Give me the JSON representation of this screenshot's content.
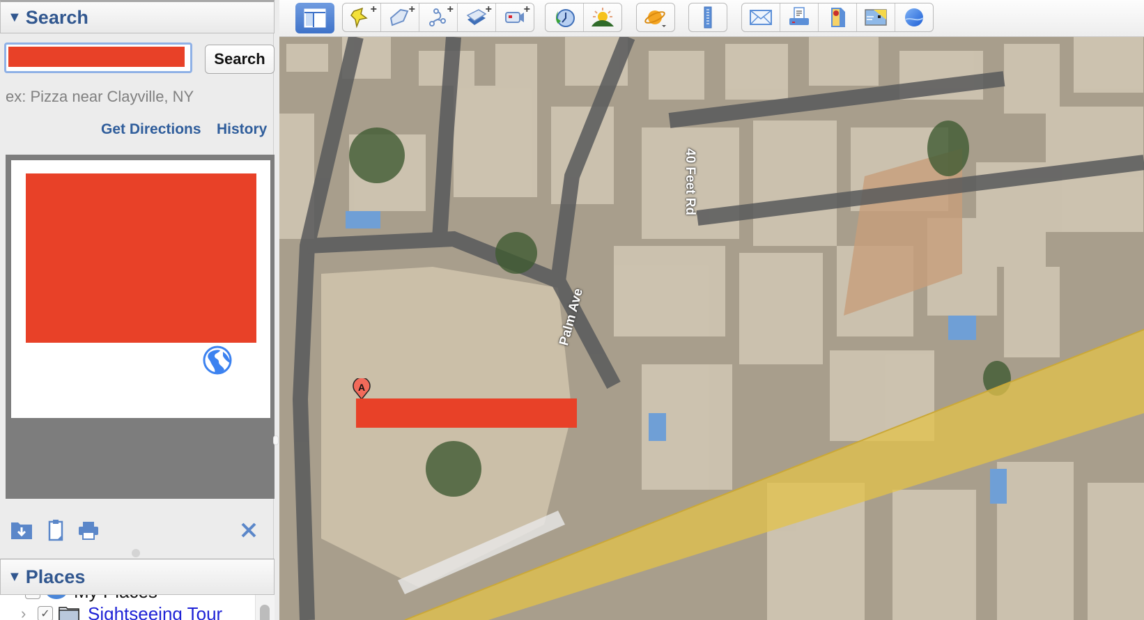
{
  "search_panel": {
    "title": "Search",
    "input_value": "",
    "input_redacted": true,
    "search_button": "Search",
    "hint": "ex: Pizza near Clayville, NY",
    "links": {
      "get_directions": "Get Directions",
      "history": "History"
    },
    "result_card": {
      "content_redacted": true,
      "icon": "globe-icon"
    },
    "tools": [
      {
        "name": "save-to-my-places",
        "icon": "folder-download-icon"
      },
      {
        "name": "copy",
        "icon": "clipboard-icon"
      },
      {
        "name": "print",
        "icon": "printer-icon"
      },
      {
        "name": "clear",
        "icon": "close-icon"
      }
    ]
  },
  "places_panel": {
    "title": "Places",
    "items": [
      {
        "label": "My Places",
        "checked": true,
        "icon": "globe-folder-icon"
      },
      {
        "label": "Sightseeing Tour",
        "checked": true,
        "icon": "folder-icon",
        "expandable": true
      }
    ]
  },
  "toolbar": {
    "groups": [
      {
        "buttons": [
          {
            "name": "hide-sidebar",
            "icon": "sidebar-icon",
            "active": true
          }
        ]
      },
      {
        "buttons": [
          {
            "name": "add-placemark",
            "icon": "pushpin-icon"
          },
          {
            "name": "add-polygon",
            "icon": "polygon-icon"
          },
          {
            "name": "add-path",
            "icon": "path-icon"
          },
          {
            "name": "add-image-overlay",
            "icon": "image-overlay-icon"
          },
          {
            "name": "record-tour",
            "icon": "video-camera-icon"
          }
        ]
      },
      {
        "buttons": [
          {
            "name": "historical-imagery",
            "icon": "clock-icon"
          },
          {
            "name": "sunlight",
            "icon": "sun-icon"
          }
        ]
      },
      {
        "buttons": [
          {
            "name": "switch-planet",
            "icon": "planet-icon"
          }
        ]
      },
      {
        "buttons": [
          {
            "name": "ruler",
            "icon": "ruler-icon"
          }
        ]
      },
      {
        "buttons": [
          {
            "name": "email",
            "icon": "envelope-icon"
          },
          {
            "name": "print",
            "icon": "printer-icon"
          },
          {
            "name": "view-in-google-maps",
            "icon": "maps-icon"
          },
          {
            "name": "save-image",
            "icon": "map-image-icon"
          },
          {
            "name": "google-earth-web",
            "icon": "earth-icon"
          }
        ]
      }
    ]
  },
  "map": {
    "road_labels": [
      "40 Feet Rd",
      "Palm Ave"
    ],
    "marker": {
      "letter": "A",
      "label_redacted": true
    },
    "highlight_color": "#e3c24a"
  },
  "colors": {
    "accent_blue": "#31578f",
    "link_blue": "#2f5d9b",
    "redaction": "#e84128",
    "tree_link": "#1f23d6"
  }
}
